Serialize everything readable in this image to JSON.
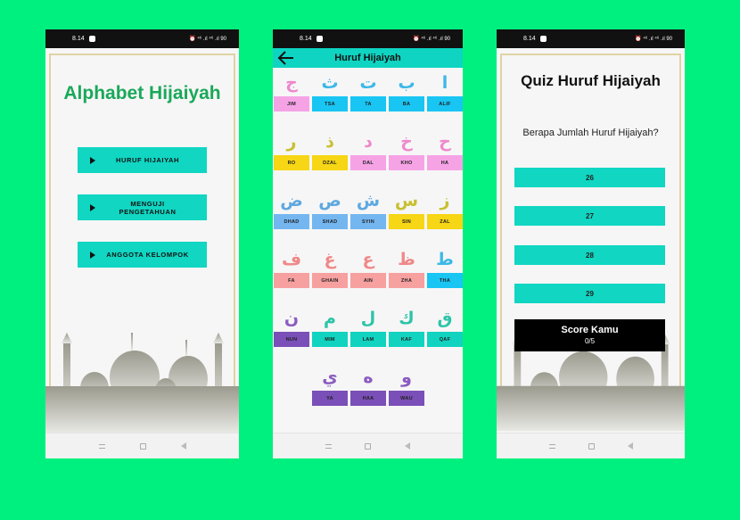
{
  "status": {
    "time": "8.14",
    "icons": "⏰ ⁴⁶ .ıl ⁴⁶ .ıl 90"
  },
  "home": {
    "title": "Alphabet Hijaiyah",
    "buttons": [
      {
        "label": "HURUF HIJAIYAH"
      },
      {
        "label": "MENGUJI\nPENGETAHUAN"
      },
      {
        "label": "ANGGOTA KELOMPOK"
      }
    ]
  },
  "letters": {
    "title": "Huruf Hijaiyah",
    "rows": [
      [
        {
          "glyph": "ج",
          "name": "JIM",
          "color": "#ee88cc",
          "bg": "#f6a3e6"
        },
        {
          "glyph": "ث",
          "name": "TSA",
          "color": "#3bb8e8",
          "bg": "#19c5f2"
        },
        {
          "glyph": "ت",
          "name": "TA",
          "color": "#3bb8e8",
          "bg": "#19c5f2"
        },
        {
          "glyph": "ب",
          "name": "BA",
          "color": "#3bb8e8",
          "bg": "#19c5f2"
        },
        {
          "glyph": "ا",
          "name": "ALIF",
          "color": "#3bb8e8",
          "bg": "#19c5f2"
        }
      ],
      [
        {
          "glyph": "ر",
          "name": "RO",
          "color": "#c8c030",
          "bg": "#f6d615"
        },
        {
          "glyph": "ذ",
          "name": "DZAL",
          "color": "#c8c030",
          "bg": "#f6d615"
        },
        {
          "glyph": "د",
          "name": "DAL",
          "color": "#ee88cc",
          "bg": "#f6a3e6"
        },
        {
          "glyph": "خ",
          "name": "KHO",
          "color": "#ee88cc",
          "bg": "#f6a3e6"
        },
        {
          "glyph": "ح",
          "name": "HA",
          "color": "#ee88cc",
          "bg": "#f6a3e6"
        }
      ],
      [
        {
          "glyph": "ض",
          "name": "DHAD",
          "color": "#5fa8e0",
          "bg": "#74b6f0"
        },
        {
          "glyph": "ص",
          "name": "SHAD",
          "color": "#5fa8e0",
          "bg": "#74b6f0"
        },
        {
          "glyph": "ش",
          "name": "SYIN",
          "color": "#5fa8e0",
          "bg": "#74b6f0"
        },
        {
          "glyph": "س",
          "name": "SIN",
          "color": "#c8c030",
          "bg": "#f6d615"
        },
        {
          "glyph": "ز",
          "name": "ZAL",
          "color": "#c8c030",
          "bg": "#f6d615"
        }
      ],
      [
        {
          "glyph": "ف",
          "name": "FA",
          "color": "#f08888",
          "bg": "#f7a0a0"
        },
        {
          "glyph": "غ",
          "name": "GHAIN",
          "color": "#f08888",
          "bg": "#f7a0a0"
        },
        {
          "glyph": "ع",
          "name": "AIN",
          "color": "#f08888",
          "bg": "#f7a0a0"
        },
        {
          "glyph": "ظ",
          "name": "ZHA",
          "color": "#f08888",
          "bg": "#f7a0a0"
        },
        {
          "glyph": "ط",
          "name": "THA",
          "color": "#3bb8e8",
          "bg": "#19c5f2"
        }
      ],
      [
        {
          "glyph": "ن",
          "name": "NUN",
          "color": "#8a5cc0",
          "bg": "#7a4fb8"
        },
        {
          "glyph": "م",
          "name": "MIM",
          "color": "#2cc4a8",
          "bg": "#12d3bf"
        },
        {
          "glyph": "ل",
          "name": "LAM",
          "color": "#2cc4a8",
          "bg": "#12d3bf"
        },
        {
          "glyph": "ك",
          "name": "KAF",
          "color": "#2cc4a8",
          "bg": "#12d3bf"
        },
        {
          "glyph": "ق",
          "name": "QAF",
          "color": "#2cc4a8",
          "bg": "#12d3bf"
        }
      ],
      [
        {
          "glyph": "ي",
          "name": "YA",
          "color": "#8a5cc0",
          "bg": "#7a4fb8"
        },
        {
          "glyph": "ه",
          "name": "HAA",
          "color": "#8a5cc0",
          "bg": "#7a4fb8"
        },
        {
          "glyph": "و",
          "name": "WAU",
          "color": "#8a5cc0",
          "bg": "#7a4fb8"
        }
      ]
    ]
  },
  "quiz": {
    "title": "Quiz Huruf Hijaiyah",
    "question": "Berapa Jumlah Huruf Hijaiyah?",
    "answers": [
      "26",
      "27",
      "28",
      "29"
    ],
    "score_label": "Score Kamu",
    "score_value": "0/5"
  }
}
